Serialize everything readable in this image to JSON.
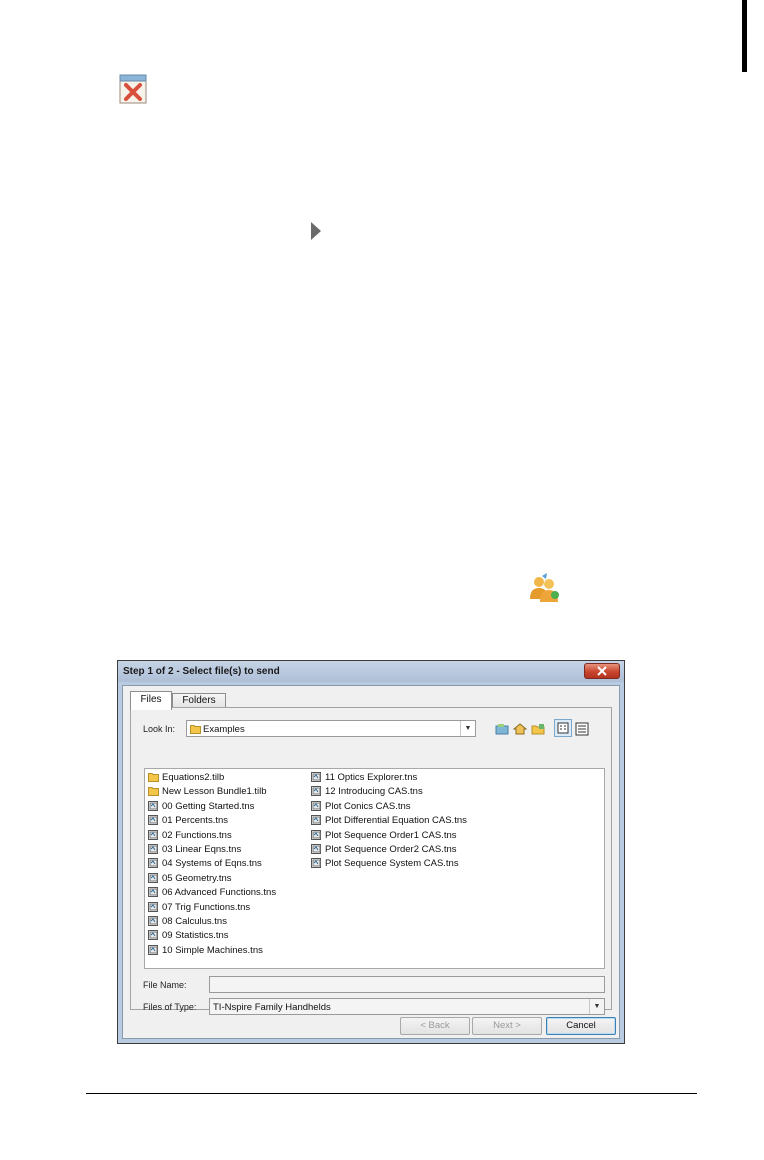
{
  "dialog": {
    "title": "Step 1 of 2 - Select file(s) to send",
    "tabs": [
      "Files",
      "Folders"
    ],
    "look_in_label": "Look In:",
    "look_in_value": "Examples",
    "files_col1": [
      {
        "name": "Equations2.tilb",
        "kind": "folder"
      },
      {
        "name": "New Lesson Bundle1.tilb",
        "kind": "folder"
      },
      {
        "name": "00 Getting Started.tns",
        "kind": "doc"
      },
      {
        "name": "01 Percents.tns",
        "kind": "doc"
      },
      {
        "name": "02 Functions.tns",
        "kind": "doc"
      },
      {
        "name": "03 Linear Eqns.tns",
        "kind": "doc"
      },
      {
        "name": "04 Systems of Eqns.tns",
        "kind": "doc"
      },
      {
        "name": "05 Geometry.tns",
        "kind": "doc"
      },
      {
        "name": "06 Advanced Functions.tns",
        "kind": "doc"
      },
      {
        "name": "07 Trig Functions.tns",
        "kind": "doc"
      },
      {
        "name": "08 Calculus.tns",
        "kind": "doc"
      },
      {
        "name": "09 Statistics.tns",
        "kind": "doc"
      },
      {
        "name": "10 Simple Machines.tns",
        "kind": "doc"
      }
    ],
    "files_col2": [
      {
        "name": "11 Optics Explorer.tns",
        "kind": "doc"
      },
      {
        "name": "12 Introducing CAS.tns",
        "kind": "doc"
      },
      {
        "name": "Plot Conics CAS.tns",
        "kind": "doc"
      },
      {
        "name": "Plot Differential Equation CAS.tns",
        "kind": "doc"
      },
      {
        "name": "Plot Sequence Order1 CAS.tns",
        "kind": "doc"
      },
      {
        "name": "Plot Sequence Order2 CAS.tns",
        "kind": "doc"
      },
      {
        "name": "Plot Sequence System CAS.tns",
        "kind": "doc"
      }
    ],
    "file_name_label": "File Name:",
    "file_name_value": "",
    "files_of_type_label": "Files of Type:",
    "files_of_type_value": "TI-Nspire Family Handhelds",
    "buttons": {
      "back": "< Back",
      "next": "Next >",
      "cancel": "Cancel"
    }
  },
  "colors": {
    "folder": "#f3c64a",
    "accent": "#c9452e"
  }
}
